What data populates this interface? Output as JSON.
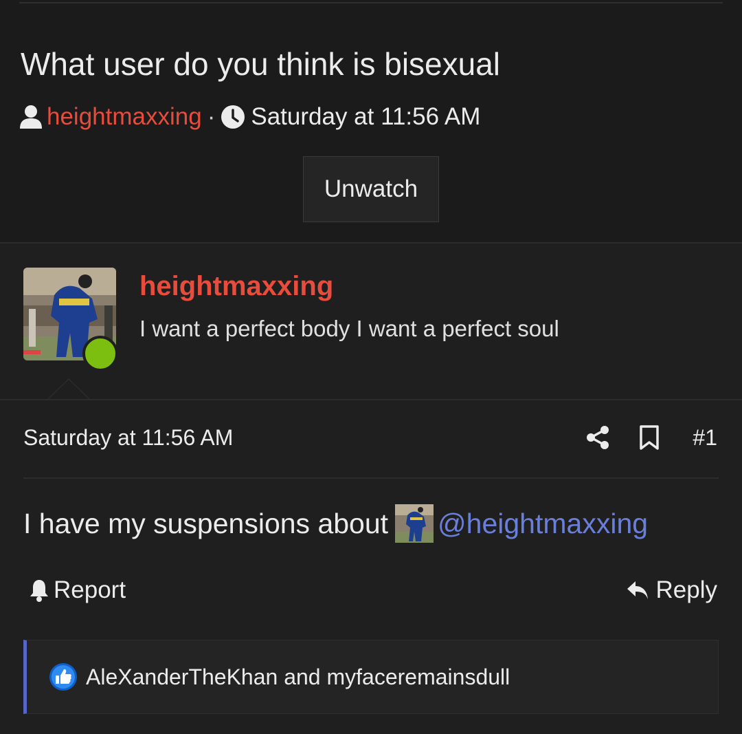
{
  "thread": {
    "title": "What user do you think is bisexual",
    "author": "heightmaxxing",
    "separator": "·",
    "date": "Saturday at 11:56 AM",
    "unwatch_label": "Unwatch"
  },
  "user": {
    "name": "heightmaxxing",
    "title": "I want a perfect body I want a perfect soul",
    "online": true
  },
  "post": {
    "date": "Saturday at 11:56 AM",
    "number": "#1",
    "message_text": "I have my suspensions about",
    "mention": "@heightmaxxing",
    "report_label": "Report",
    "reply_label": "Reply"
  },
  "reactions": {
    "text": "AleXanderTheKhan and myfaceremainsdull"
  },
  "colors": {
    "author": "#e74c3c",
    "mention": "#6a7fd9",
    "online": "#7cbf10",
    "reaction_accent": "#5865c8"
  }
}
